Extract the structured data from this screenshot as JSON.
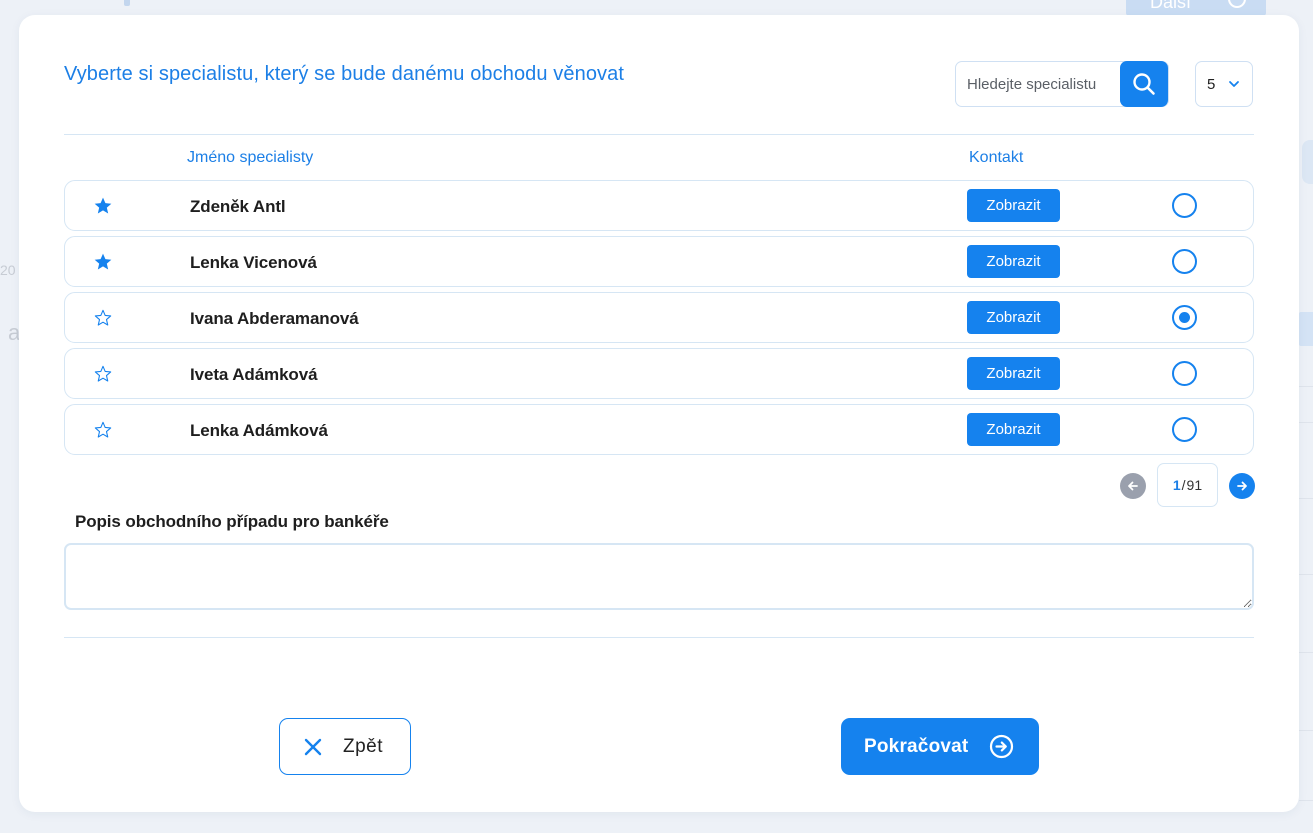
{
  "background": {
    "top_text": "",
    "top_button_label": "Další",
    "left_fragments": [
      "20",
      "a"
    ],
    "right_fragments": [
      "dn",
      "na",
      "na",
      "na",
      "na",
      "na",
      "na"
    ]
  },
  "modal": {
    "title": "Vyberte si specialistu, který se bude danému obchodu věnovat",
    "search": {
      "placeholder": "Hledejte specialistu",
      "value": "",
      "button_icon": "search-icon"
    },
    "page_size": {
      "selected": "5",
      "icon": "chevron-down-icon"
    },
    "table": {
      "columns": {
        "name": "Jméno specialisty",
        "contact": "Kontakt"
      },
      "rows": [
        {
          "favorite": true,
          "name": "Zdeněk Antl",
          "contact_label": "Zobrazit",
          "selected": false
        },
        {
          "favorite": true,
          "name": "Lenka Vicenová",
          "contact_label": "Zobrazit",
          "selected": false
        },
        {
          "favorite": false,
          "name": "Ivana Abderamanová",
          "contact_label": "Zobrazit",
          "selected": true
        },
        {
          "favorite": false,
          "name": "Iveta Adámková",
          "contact_label": "Zobrazit",
          "selected": false
        },
        {
          "favorite": false,
          "name": "Lenka Adámková",
          "contact_label": "Zobrazit",
          "selected": false
        }
      ]
    },
    "pagination": {
      "current": "1",
      "separator": "/",
      "total": "91"
    },
    "description": {
      "label": "Popis obchodního případu pro bankéře",
      "value": ""
    },
    "footer": {
      "back_label": "Zpět",
      "continue_label": "Pokračovat"
    },
    "colors": {
      "accent": "#1582ee",
      "title": "#1c7fe6",
      "border": "#d6e6f4",
      "pagination_prev": "#9aa0ad"
    }
  }
}
